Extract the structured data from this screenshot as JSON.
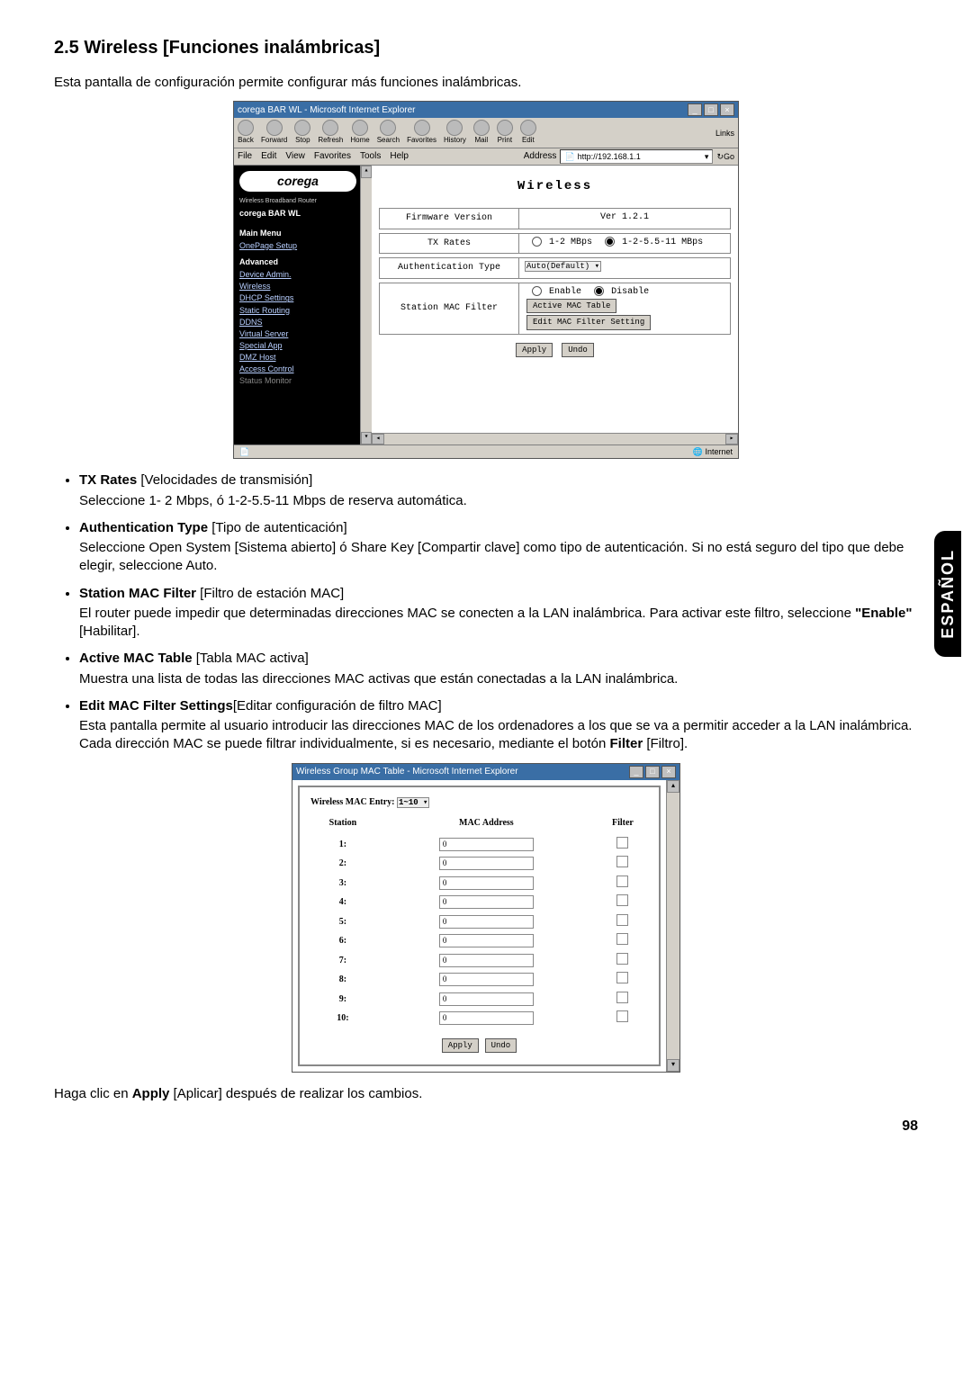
{
  "heading": "2.5 Wireless [Funciones inalámbricas]",
  "intro": "Esta pantalla de configuración permite configurar más funciones inalámbricas.",
  "side_tab": "ESPAÑOL",
  "page_number": "98",
  "ie1": {
    "title": "corega BAR WL - Microsoft Internet Explorer",
    "toolbar": {
      "back": "Back",
      "forward": "Forward",
      "stop": "Stop",
      "refresh": "Refresh",
      "home": "Home",
      "search": "Search",
      "favorites": "Favorites",
      "history": "History",
      "mail": "Mail",
      "print": "Print",
      "edit": "Edit",
      "links": "Links"
    },
    "menubar": {
      "file": "File",
      "edit": "Edit",
      "view": "View",
      "favorites_m": "Favorites",
      "tools": "Tools",
      "help": "Help",
      "address_label": "Address",
      "address_value": "http://192.168.1.1",
      "go": "Go"
    },
    "sidebar": {
      "logo": "corega",
      "sub": "Wireless Broadband Router",
      "model": "corega  BAR WL",
      "main_menu_head": "Main Menu",
      "main_links": [
        "OnePage Setup"
      ],
      "advanced_head": "Advanced",
      "adv_links": [
        "Device Admin.",
        "Wireless",
        "DHCP Settings",
        "Static Routing",
        "DDNS",
        "Virtual Server",
        "Special App",
        "DMZ Host",
        "Access Control",
        "Status Monitor"
      ]
    },
    "content": {
      "page_title": "Wireless",
      "firmware_label": "Firmware Version",
      "firmware_value": "Ver 1.2.1",
      "txrates_label": "TX Rates",
      "txrates_opt1": "1-2 MBps",
      "txrates_opt2": "1-2-5.5-11 MBps",
      "auth_label": "Authentication Type",
      "auth_value": "Auto(Default)",
      "macfilter_label": "Station MAC Filter",
      "enable": "Enable",
      "disable": "Disable",
      "active_mac_btn": "Active MAC Table",
      "edit_mac_btn": "Edit MAC Filter Setting",
      "apply": "Apply",
      "undo": "Undo"
    },
    "status": {
      "left": "",
      "right": "Internet"
    }
  },
  "bullets": {
    "b1": {
      "term": "TX Rates",
      "trans": "[Velocidades de transmisión]",
      "text": "Seleccione 1- 2 Mbps, ó 1-2-5.5-11 Mbps de reserva automática."
    },
    "b2": {
      "term": "Authentication Type",
      "trans": "[Tipo de autenticación]",
      "text": "Seleccione Open System [Sistema abierto] ó Share Key [Compartir clave] como tipo de autenticación. Si no está seguro del tipo que debe elegir, seleccione Auto."
    },
    "b3": {
      "term": "Station MAC Filter",
      "trans": "[Filtro de estación MAC]",
      "text_a": "El router puede impedir que determinadas direcciones MAC se conecten a la LAN inalámbrica. Para activar este filtro, seleccione ",
      "enable_quote": "\"Enable\"",
      "text_b": " [Habilitar]."
    },
    "b4": {
      "term": "Active MAC Table",
      "trans": "[Tabla MAC activa]",
      "text": "Muestra una lista de todas las direcciones MAC activas que están conectadas a la LAN inalámbrica."
    },
    "b5": {
      "term": "Edit MAC Filter Settings",
      "trans": "[Editar configuración de filtro MAC]",
      "text_a": "Esta pantalla permite al usuario introducir las direcciones MAC de los ordenadores a los que se va a permitir acceder a la LAN inalámbrica. Cada dirección MAC se puede filtrar individualmente, si es necesario, mediante el botón ",
      "filter_word": "Filter",
      "text_b": " [Filtro]."
    }
  },
  "ie2": {
    "title": "Wireless Group MAC Table - Microsoft Internet Explorer",
    "entry_label": "Wireless MAC Entry:",
    "entry_value": "1~10",
    "col_station": "Station",
    "col_mac": "MAC Address",
    "col_filter": "Filter",
    "rows": [
      {
        "n": "1:",
        "v": "0"
      },
      {
        "n": "2:",
        "v": "0"
      },
      {
        "n": "3:",
        "v": "0"
      },
      {
        "n": "4:",
        "v": "0"
      },
      {
        "n": "5:",
        "v": "0"
      },
      {
        "n": "6:",
        "v": "0"
      },
      {
        "n": "7:",
        "v": "0"
      },
      {
        "n": "8:",
        "v": "0"
      },
      {
        "n": "9:",
        "v": "0"
      },
      {
        "n": "10:",
        "v": "0"
      }
    ],
    "apply": "Apply",
    "undo": "Undo"
  },
  "footer_a": "Haga clic en ",
  "footer_bold": "Apply",
  "footer_b": " [Aplicar] después de realizar los cambios."
}
